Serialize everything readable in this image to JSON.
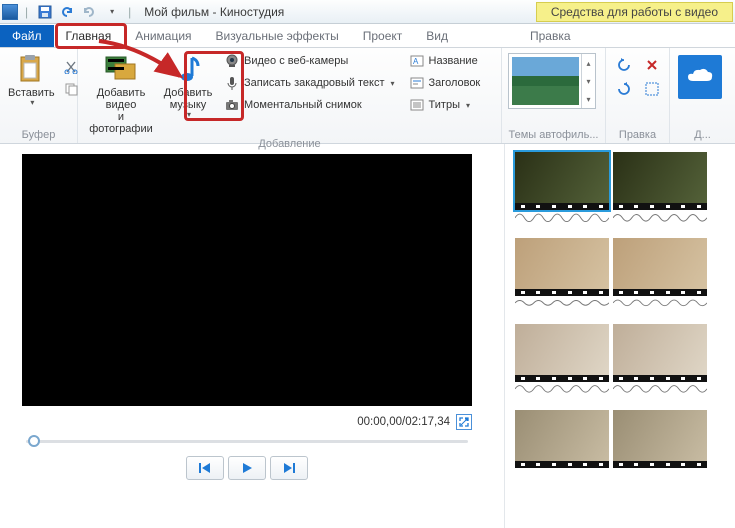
{
  "titlebar": {
    "title": "Мой фильм - Киностудия"
  },
  "context_tab": {
    "label": "Средства для работы с видео",
    "sublabel": "Правка"
  },
  "tabs": {
    "file": "Файл",
    "home": "Главная",
    "animation": "Анимация",
    "vfx": "Визуальные эффекты",
    "project": "Проект",
    "view": "Вид"
  },
  "ribbon": {
    "buffer": {
      "label": "Буфер",
      "paste": "Вставить"
    },
    "add": {
      "label": "Добавление",
      "add_media": "Добавить видео\nи фотографии",
      "add_music": "Добавить\nмузыку",
      "webcam": "Видео с веб-камеры",
      "voice": "Записать закадровый текст",
      "snapshot": "Моментальный снимок",
      "title": "Название",
      "heading": "Заголовок",
      "credits": "Титры"
    },
    "themes": {
      "label": "Темы автофиль..."
    },
    "edit": {
      "label": "Правка"
    },
    "share": {
      "label": "Д..."
    }
  },
  "preview": {
    "time": "00:00,00/02:17,34"
  }
}
